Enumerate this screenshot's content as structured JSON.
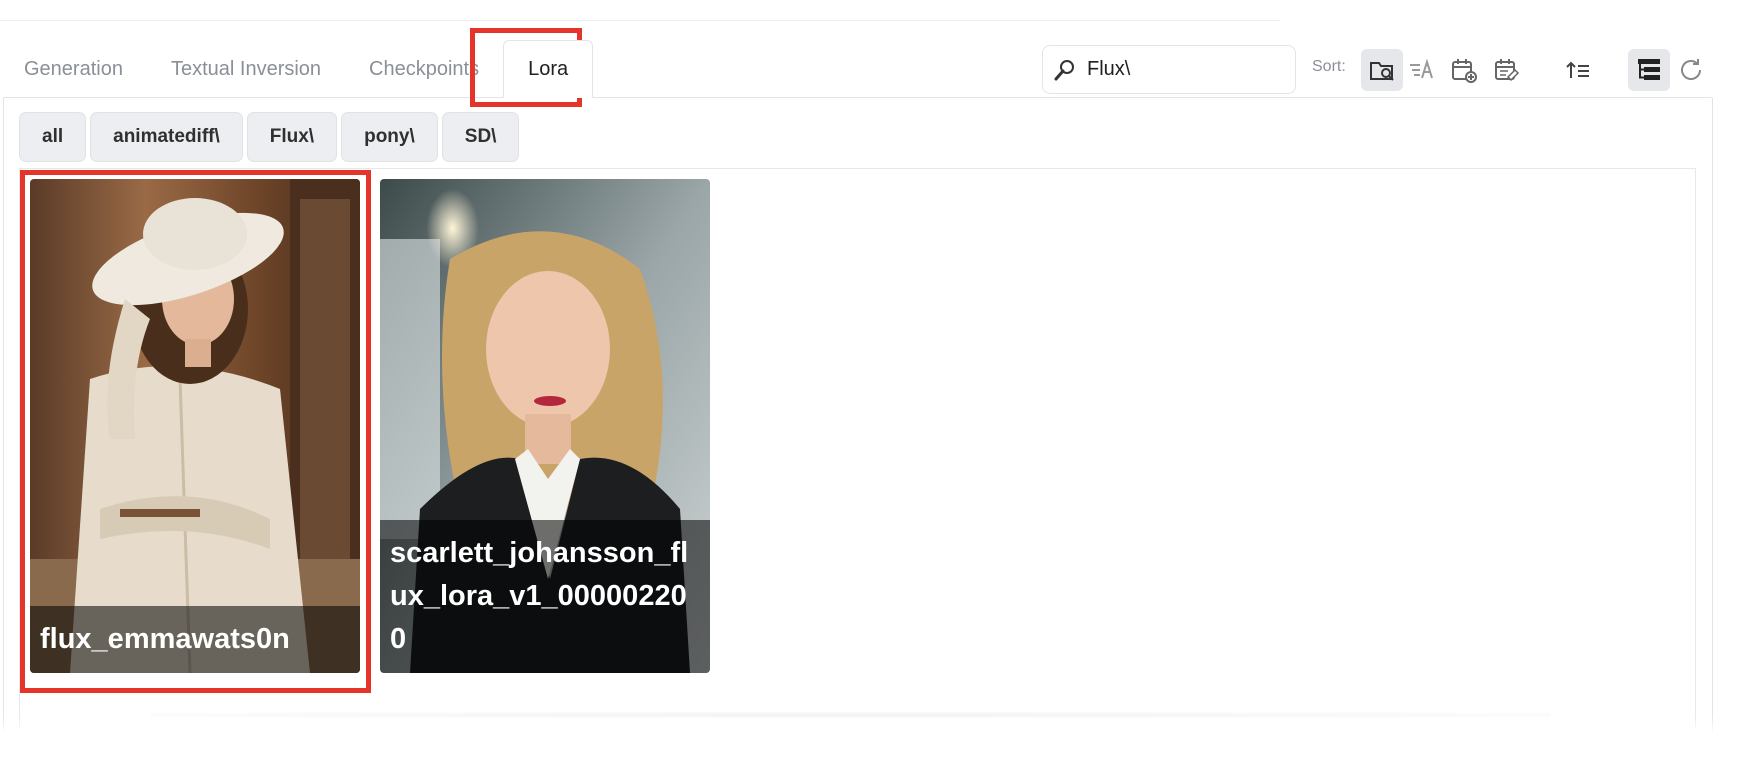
{
  "tabs": [
    {
      "label": "Generation"
    },
    {
      "label": "Textual Inversion"
    },
    {
      "label": "Checkpoints"
    },
    {
      "label": "Lora",
      "active": true
    }
  ],
  "search": {
    "value": "Flux\\",
    "icon": "magnifier-icon"
  },
  "sort": {
    "label": "Sort:",
    "tools": [
      {
        "name": "sort-by-path",
        "icon": "folder-search-icon",
        "active": true
      },
      {
        "name": "sort-by-name",
        "icon": "sort-alpha-icon"
      },
      {
        "name": "sort-by-date-created",
        "icon": "calendar-plus-icon"
      },
      {
        "name": "sort-by-date-modified",
        "icon": "calendar-edit-icon"
      },
      {
        "name": "sort-direction",
        "icon": "sort-ascending-icon"
      },
      {
        "name": "tree-view",
        "icon": "tree-view-icon",
        "active": true
      },
      {
        "name": "refresh",
        "icon": "refresh-icon"
      }
    ]
  },
  "dirs": [
    {
      "label": "all"
    },
    {
      "label": "animatediff\\"
    },
    {
      "label": "Flux\\"
    },
    {
      "label": "pony\\"
    },
    {
      "label": "SD\\"
    }
  ],
  "cards": [
    {
      "name": "flux_emmawats0n"
    },
    {
      "name": "scarlett_johansson_flux_lora_v1_000002200"
    }
  ],
  "colors": {
    "highlight": "#e5352b",
    "tool_active_bg": "#e5e7eb"
  }
}
